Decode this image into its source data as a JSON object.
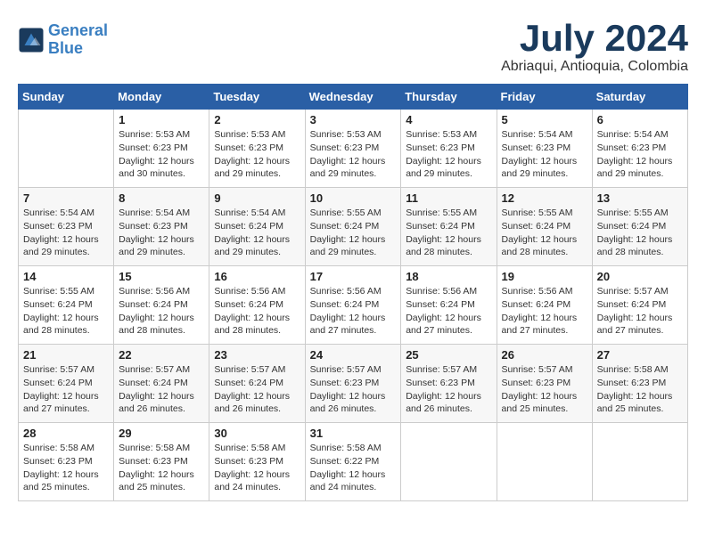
{
  "header": {
    "logo_line1": "General",
    "logo_line2": "Blue",
    "month_year": "July 2024",
    "location": "Abriaqui, Antioquia, Colombia"
  },
  "days_of_week": [
    "Sunday",
    "Monday",
    "Tuesday",
    "Wednesday",
    "Thursday",
    "Friday",
    "Saturday"
  ],
  "weeks": [
    [
      {
        "day": "",
        "info": ""
      },
      {
        "day": "1",
        "info": "Sunrise: 5:53 AM\nSunset: 6:23 PM\nDaylight: 12 hours\nand 30 minutes."
      },
      {
        "day": "2",
        "info": "Sunrise: 5:53 AM\nSunset: 6:23 PM\nDaylight: 12 hours\nand 29 minutes."
      },
      {
        "day": "3",
        "info": "Sunrise: 5:53 AM\nSunset: 6:23 PM\nDaylight: 12 hours\nand 29 minutes."
      },
      {
        "day": "4",
        "info": "Sunrise: 5:53 AM\nSunset: 6:23 PM\nDaylight: 12 hours\nand 29 minutes."
      },
      {
        "day": "5",
        "info": "Sunrise: 5:54 AM\nSunset: 6:23 PM\nDaylight: 12 hours\nand 29 minutes."
      },
      {
        "day": "6",
        "info": "Sunrise: 5:54 AM\nSunset: 6:23 PM\nDaylight: 12 hours\nand 29 minutes."
      }
    ],
    [
      {
        "day": "7",
        "info": "Sunrise: 5:54 AM\nSunset: 6:23 PM\nDaylight: 12 hours\nand 29 minutes."
      },
      {
        "day": "8",
        "info": "Sunrise: 5:54 AM\nSunset: 6:23 PM\nDaylight: 12 hours\nand 29 minutes."
      },
      {
        "day": "9",
        "info": "Sunrise: 5:54 AM\nSunset: 6:24 PM\nDaylight: 12 hours\nand 29 minutes."
      },
      {
        "day": "10",
        "info": "Sunrise: 5:55 AM\nSunset: 6:24 PM\nDaylight: 12 hours\nand 29 minutes."
      },
      {
        "day": "11",
        "info": "Sunrise: 5:55 AM\nSunset: 6:24 PM\nDaylight: 12 hours\nand 28 minutes."
      },
      {
        "day": "12",
        "info": "Sunrise: 5:55 AM\nSunset: 6:24 PM\nDaylight: 12 hours\nand 28 minutes."
      },
      {
        "day": "13",
        "info": "Sunrise: 5:55 AM\nSunset: 6:24 PM\nDaylight: 12 hours\nand 28 minutes."
      }
    ],
    [
      {
        "day": "14",
        "info": "Sunrise: 5:55 AM\nSunset: 6:24 PM\nDaylight: 12 hours\nand 28 minutes."
      },
      {
        "day": "15",
        "info": "Sunrise: 5:56 AM\nSunset: 6:24 PM\nDaylight: 12 hours\nand 28 minutes."
      },
      {
        "day": "16",
        "info": "Sunrise: 5:56 AM\nSunset: 6:24 PM\nDaylight: 12 hours\nand 28 minutes."
      },
      {
        "day": "17",
        "info": "Sunrise: 5:56 AM\nSunset: 6:24 PM\nDaylight: 12 hours\nand 27 minutes."
      },
      {
        "day": "18",
        "info": "Sunrise: 5:56 AM\nSunset: 6:24 PM\nDaylight: 12 hours\nand 27 minutes."
      },
      {
        "day": "19",
        "info": "Sunrise: 5:56 AM\nSunset: 6:24 PM\nDaylight: 12 hours\nand 27 minutes."
      },
      {
        "day": "20",
        "info": "Sunrise: 5:57 AM\nSunset: 6:24 PM\nDaylight: 12 hours\nand 27 minutes."
      }
    ],
    [
      {
        "day": "21",
        "info": "Sunrise: 5:57 AM\nSunset: 6:24 PM\nDaylight: 12 hours\nand 27 minutes."
      },
      {
        "day": "22",
        "info": "Sunrise: 5:57 AM\nSunset: 6:24 PM\nDaylight: 12 hours\nand 26 minutes."
      },
      {
        "day": "23",
        "info": "Sunrise: 5:57 AM\nSunset: 6:24 PM\nDaylight: 12 hours\nand 26 minutes."
      },
      {
        "day": "24",
        "info": "Sunrise: 5:57 AM\nSunset: 6:23 PM\nDaylight: 12 hours\nand 26 minutes."
      },
      {
        "day": "25",
        "info": "Sunrise: 5:57 AM\nSunset: 6:23 PM\nDaylight: 12 hours\nand 26 minutes."
      },
      {
        "day": "26",
        "info": "Sunrise: 5:57 AM\nSunset: 6:23 PM\nDaylight: 12 hours\nand 25 minutes."
      },
      {
        "day": "27",
        "info": "Sunrise: 5:58 AM\nSunset: 6:23 PM\nDaylight: 12 hours\nand 25 minutes."
      }
    ],
    [
      {
        "day": "28",
        "info": "Sunrise: 5:58 AM\nSunset: 6:23 PM\nDaylight: 12 hours\nand 25 minutes."
      },
      {
        "day": "29",
        "info": "Sunrise: 5:58 AM\nSunset: 6:23 PM\nDaylight: 12 hours\nand 25 minutes."
      },
      {
        "day": "30",
        "info": "Sunrise: 5:58 AM\nSunset: 6:23 PM\nDaylight: 12 hours\nand 24 minutes."
      },
      {
        "day": "31",
        "info": "Sunrise: 5:58 AM\nSunset: 6:22 PM\nDaylight: 12 hours\nand 24 minutes."
      },
      {
        "day": "",
        "info": ""
      },
      {
        "day": "",
        "info": ""
      },
      {
        "day": "",
        "info": ""
      }
    ]
  ]
}
